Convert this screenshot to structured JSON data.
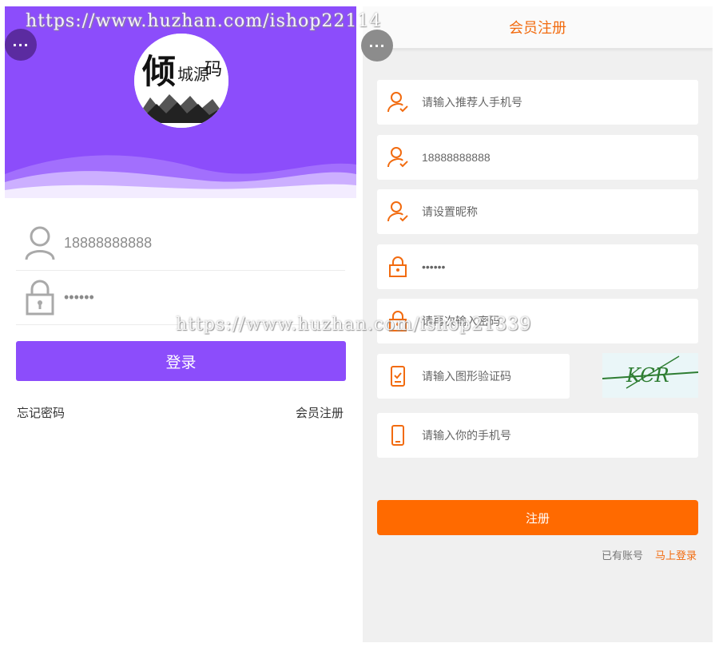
{
  "login": {
    "phone_value": "18888888888",
    "password_value": "••••••",
    "login_label": "登录",
    "forgot_label": "忘记密码",
    "register_link_label": "会员注册",
    "logo_text": "倾城源码",
    "more_label": "···"
  },
  "register": {
    "title": "会员注册",
    "more_label": "···",
    "fields": [
      {
        "text": "请输入推荐人手机号",
        "icon": "user-check-icon"
      },
      {
        "text": "18888888888",
        "icon": "user-check-icon"
      },
      {
        "text": "请设置昵称",
        "icon": "user-check-icon"
      },
      {
        "text": "••••••",
        "icon": "lock-icon"
      },
      {
        "text": "请再次输入密码",
        "icon": "lock-icon"
      },
      {
        "text": "请输入图形验证码",
        "icon": "captcha-icon"
      },
      {
        "text": "请输入你的手机号",
        "icon": "mobile-icon"
      }
    ],
    "captcha_text": "KCR",
    "submit_label": "注册",
    "has_account_label": "已有账号",
    "login_now_label": "马上登录"
  },
  "watermarks": {
    "top": "https://www.huzhan.com/ishop22114",
    "middle": "https://www.huzhan.com/ishop21339"
  },
  "colors": {
    "login_accent": "#8c4dfb",
    "register_accent": "#ff6a00",
    "register_text_accent": "#f26b0f"
  }
}
